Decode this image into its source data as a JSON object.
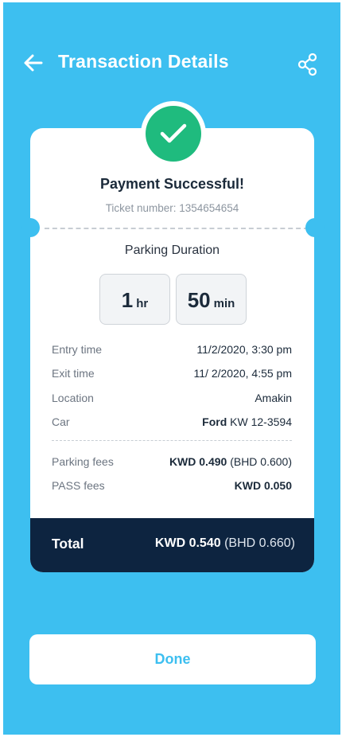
{
  "header": {
    "title": "Transaction Details",
    "back_icon": "arrow-left-icon",
    "share_icon": "share-icon"
  },
  "status": {
    "icon": "check-icon",
    "title": "Payment Successful!",
    "ticket_text": "Ticket number: 1354654654"
  },
  "duration": {
    "label": "Parking Duration",
    "hours": "1",
    "hours_unit": "hr",
    "minutes": "50",
    "minutes_unit": "min"
  },
  "details": [
    {
      "label": "Entry time",
      "value": "11/2/2020, 3:30 pm"
    },
    {
      "label": "Exit time",
      "value": "11/ 2/2020, 4:55 pm"
    },
    {
      "label": "Location",
      "value": "Amakin"
    },
    {
      "label": "Car",
      "value_bold": "Ford",
      "value": "KW 12-3594"
    }
  ],
  "fees": [
    {
      "label": "Parking fees",
      "value_bold": "KWD 0.490",
      "value": "(BHD 0.600)"
    },
    {
      "label": "PASS fees",
      "value_bold": "KWD 0.050",
      "value": ""
    }
  ],
  "total": {
    "label": "Total",
    "value_bold": "KWD 0.540",
    "value": "(BHD 0.660)"
  },
  "actions": {
    "done_label": "Done"
  },
  "colors": {
    "background": "#3dbff0",
    "success": "#1fbb7e",
    "total_bar": "#0d2440",
    "text_dark": "#1b2a3a"
  }
}
